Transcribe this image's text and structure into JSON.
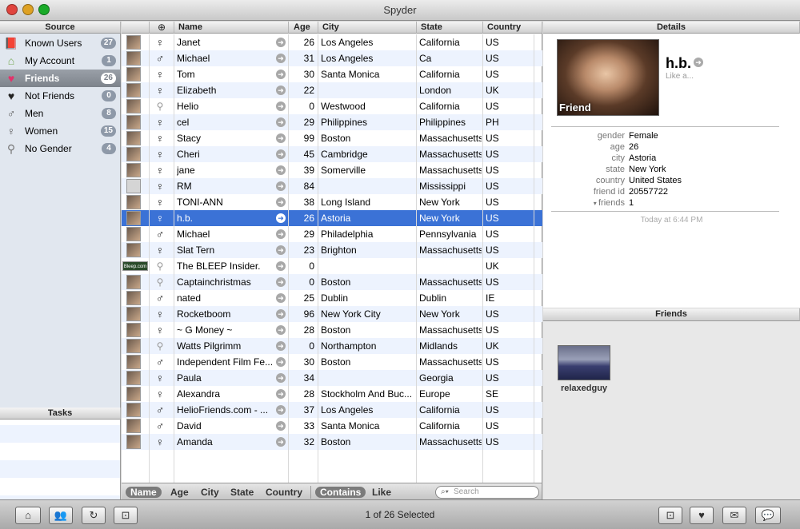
{
  "window": {
    "title": "Spyder"
  },
  "source": {
    "header": "Source",
    "items": [
      {
        "label": "Known Users",
        "count": "27",
        "icon": "book-icon"
      },
      {
        "label": "My Account",
        "count": "1",
        "icon": "house-icon"
      },
      {
        "label": "Friends",
        "count": "26",
        "icon": "heart-icon",
        "selected": true
      },
      {
        "label": "Not Friends",
        "count": "0",
        "icon": "black-heart-icon"
      },
      {
        "label": "Men",
        "count": "8",
        "icon": "male-icon"
      },
      {
        "label": "Women",
        "count": "15",
        "icon": "female-icon"
      },
      {
        "label": "No Gender",
        "count": "4",
        "icon": "no-gender-icon"
      }
    ]
  },
  "tasks": {
    "header": "Tasks"
  },
  "table": {
    "columns": [
      "Name",
      "Age",
      "City",
      "State",
      "Country"
    ],
    "rows": [
      {
        "name": "Janet",
        "gender": "female",
        "age": "26",
        "city": "Los Angeles",
        "state": "California",
        "country": "US"
      },
      {
        "name": "Michael",
        "gender": "male",
        "age": "31",
        "city": "Los Angeles",
        "state": "Ca",
        "country": "US"
      },
      {
        "name": "Tom",
        "gender": "female",
        "age": "30",
        "city": "Santa Monica",
        "state": "California",
        "country": "US"
      },
      {
        "name": "Elizabeth",
        "gender": "female",
        "age": "22",
        "city": "",
        "state": "London",
        "country": "UK"
      },
      {
        "name": "Helio",
        "gender": "none",
        "age": "0",
        "city": "Westwood",
        "state": "California",
        "country": "US"
      },
      {
        "name": "cel",
        "gender": "female",
        "age": "29",
        "city": "Philippines",
        "state": "Philippines",
        "country": "PH"
      },
      {
        "name": "Stacy",
        "gender": "female",
        "age": "99",
        "city": "Boston",
        "state": "Massachusetts",
        "country": "US"
      },
      {
        "name": "Cheri",
        "gender": "female",
        "age": "45",
        "city": "Cambridge",
        "state": "Massachusetts",
        "country": "US"
      },
      {
        "name": "jane",
        "gender": "female",
        "age": "39",
        "city": "Somerville",
        "state": "Massachusetts",
        "country": "US"
      },
      {
        "name": "RM",
        "gender": "female",
        "age": "84",
        "city": "",
        "state": "Mississippi",
        "country": "US"
      },
      {
        "name": "TONI-ANN",
        "gender": "female",
        "age": "38",
        "city": "Long Island",
        "state": "New York",
        "country": "US"
      },
      {
        "name": "h.b.",
        "gender": "female",
        "age": "26",
        "city": "Astoria",
        "state": "New York",
        "country": "US",
        "selected": true
      },
      {
        "name": "Michael",
        "gender": "male",
        "age": "29",
        "city": "Philadelphia",
        "state": "Pennsylvania",
        "country": "US"
      },
      {
        "name": "Slat Tern",
        "gender": "female",
        "age": "23",
        "city": "Brighton",
        "state": "Massachusetts",
        "country": "US"
      },
      {
        "name": "The BLEEP Insider.",
        "gender": "none",
        "age": "0",
        "city": "",
        "state": "",
        "country": "UK",
        "thumb": "Bleep.com"
      },
      {
        "name": "Captainchristmas",
        "gender": "none",
        "age": "0",
        "city": "Boston",
        "state": "Massachusetts",
        "country": "US"
      },
      {
        "name": "nated",
        "gender": "male",
        "age": "25",
        "city": "Dublin",
        "state": "Dublin",
        "country": "IE"
      },
      {
        "name": "Rocketboom",
        "gender": "female",
        "age": "96",
        "city": "New York City",
        "state": "New York",
        "country": "US"
      },
      {
        "name": "~ G Money ~",
        "gender": "female",
        "age": "28",
        "city": "Boston",
        "state": "Massachusetts",
        "country": "US"
      },
      {
        "name": "Watts Pilgrimm",
        "gender": "none",
        "age": "0",
        "city": "Northampton",
        "state": "Midlands",
        "country": "UK"
      },
      {
        "name": "Independent Film Fe...",
        "gender": "male",
        "age": "30",
        "city": "Boston",
        "state": "Massachusetts",
        "country": "US"
      },
      {
        "name": "Paula",
        "gender": "female",
        "age": "34",
        "city": "",
        "state": "Georgia",
        "country": "US"
      },
      {
        "name": "Alexandra",
        "gender": "female",
        "age": "28",
        "city": "Stockholm And Buc...",
        "state": "Europe",
        "country": "SE"
      },
      {
        "name": "HelioFriends.com - ...",
        "gender": "male",
        "age": "37",
        "city": "Los Angeles",
        "state": "California",
        "country": "US"
      },
      {
        "name": "David",
        "gender": "male",
        "age": "33",
        "city": "Santa Monica",
        "state": "California",
        "country": "US"
      },
      {
        "name": "Amanda",
        "gender": "female",
        "age": "32",
        "city": "Boston",
        "state": "Massachusetts",
        "country": "US"
      }
    ]
  },
  "filter": {
    "fields": [
      "Name",
      "Age",
      "City",
      "State",
      "Country"
    ],
    "active_field": "Name",
    "modes": [
      "Contains",
      "Like"
    ],
    "active_mode": "Contains",
    "search_placeholder": "Search"
  },
  "details": {
    "header": "Details",
    "photo_caption": "Friend",
    "name": "h.b.",
    "subtitle": "Like a...",
    "fields": [
      {
        "key": "gender",
        "value": "Female"
      },
      {
        "key": "age",
        "value": "26"
      },
      {
        "key": "city",
        "value": "Astoria"
      },
      {
        "key": "state",
        "value": "New York"
      },
      {
        "key": "country",
        "value": "United States"
      },
      {
        "key": "friend id",
        "value": "20557722"
      },
      {
        "key": "friends",
        "value": "1"
      }
    ],
    "timestamp": "Today at 6:44 PM"
  },
  "friends": {
    "header": "Friends",
    "items": [
      {
        "name": "relaxedguy"
      }
    ]
  },
  "status": "1 of 26 Selected",
  "colors": {
    "selection": "#3b72d6",
    "row_alt": "#edf3fe",
    "source_bg": "#e1e7ef",
    "badge": "#8e99a8"
  }
}
